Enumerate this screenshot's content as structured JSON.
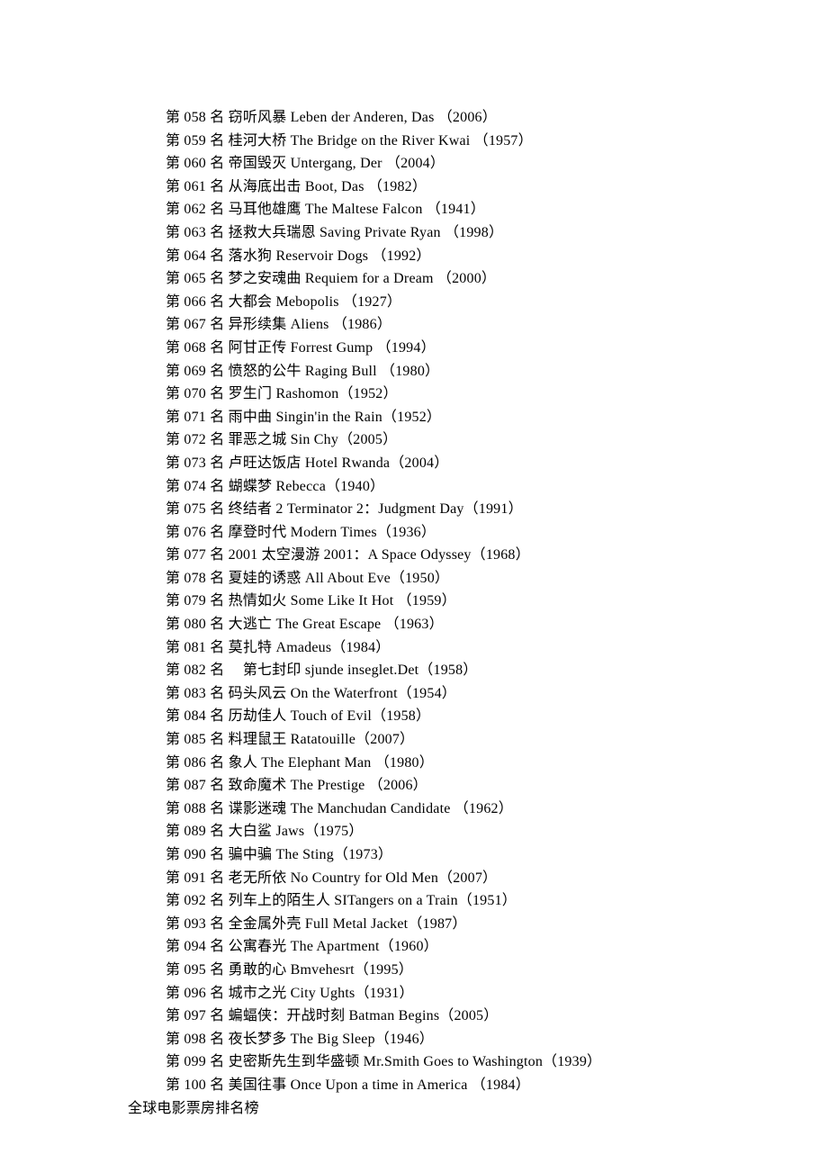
{
  "movies": {
    "items": [
      {
        "rank": "058",
        "cn": "窃听风暴",
        "en": "Leben der Anderen, Das ",
        "year": "（2006）"
      },
      {
        "rank": "059",
        "cn": "桂河大桥",
        "en": "The Bridge on the River Kwai ",
        "year": "（1957）"
      },
      {
        "rank": "060",
        "cn": "帝国毁灭",
        "en": "Untergang, Der ",
        "year": "（2004）"
      },
      {
        "rank": "061",
        "cn": "从海底出击",
        "en": "Boot, Das ",
        "year": "（1982）"
      },
      {
        "rank": "062",
        "cn": "马耳他雄鹰",
        "en": "The Maltese Falcon ",
        "year": "（1941）"
      },
      {
        "rank": "063",
        "cn": "拯救大兵瑞恩",
        "en": "Saving Private Ryan ",
        "year": "（1998）"
      },
      {
        "rank": "064",
        "cn": "落水狗",
        "en": "Reservoir Dogs ",
        "year": "（1992）"
      },
      {
        "rank": "065",
        "cn": "梦之安魂曲",
        "en": "Requiem for a Dream ",
        "year": "（2000）"
      },
      {
        "rank": "066",
        "cn": "大都会",
        "en": "Mebopolis ",
        "year": "（1927）"
      },
      {
        "rank": "067",
        "cn": "异形续集",
        "en": "Aliens ",
        "year": "（1986）"
      },
      {
        "rank": "068",
        "cn": "阿甘正传",
        "en": "Forrest Gump ",
        "year": "（1994）"
      },
      {
        "rank": "069",
        "cn": "愤怒的公牛",
        "en": "Raging Bull ",
        "year": "（1980）"
      },
      {
        "rank": "070",
        "cn": "罗生门",
        "en": "Rashomon",
        "year": "（1952）"
      },
      {
        "rank": "071",
        "cn": "雨中曲",
        "en": "Singin'in the Rain",
        "year": "（1952）"
      },
      {
        "rank": "072",
        "cn": "罪恶之城",
        "en": "Sin Chy",
        "year": "（2005）"
      },
      {
        "rank": "073",
        "cn": "卢旺达饭店",
        "en": "Hotel Rwanda",
        "year": "（2004）"
      },
      {
        "rank": "074",
        "cn": "蝴蝶梦",
        "en": "Rebecca",
        "year": "（1940）"
      },
      {
        "rank": "075",
        "cn": "终结者 2",
        "en": "Terminator 2：Judgment Day",
        "year": "（1991）"
      },
      {
        "rank": "076",
        "cn": "摩登时代",
        "en": "Modern Times",
        "year": "（1936）"
      },
      {
        "rank": "077",
        "cn": "2001 太空漫游",
        "en": "2001：A Space Odyssey",
        "year": "（1968）"
      },
      {
        "rank": "078",
        "cn": "夏娃的诱惑",
        "en": "All About Eve",
        "year": "（1950）"
      },
      {
        "rank": "079",
        "cn": "热情如火",
        "en": "Some Like It Hot ",
        "year": "（1959）"
      },
      {
        "rank": "080",
        "cn": "大逃亡",
        "en": "The Great Escape ",
        "year": "（1963）"
      },
      {
        "rank": "081",
        "cn": "莫扎特",
        "en": "Amadeus",
        "year": "（1984）"
      },
      {
        "rank": "082",
        "cn": "　第七封印",
        "en": "sjunde inseglet.Det",
        "year": "（1958）"
      },
      {
        "rank": "083",
        "cn": "码头风云",
        "en": "On the Waterfront",
        "year": "（1954）"
      },
      {
        "rank": "084",
        "cn": "历劫佳人",
        "en": "Touch of Evil",
        "year": "（1958）"
      },
      {
        "rank": "085",
        "cn": "料理鼠王",
        "en": "Ratatouille",
        "year": "（2007）"
      },
      {
        "rank": "086",
        "cn": "象人",
        "en": "The Elephant Man ",
        "year": "（1980）"
      },
      {
        "rank": "087",
        "cn": "致命魔术",
        "en": "The Prestige ",
        "year": "（2006）"
      },
      {
        "rank": "088",
        "cn": "谍影迷魂",
        "en": "The Manchudan Candidate ",
        "year": "（1962）"
      },
      {
        "rank": "089",
        "cn": "大白鲨",
        "en": "Jaws",
        "year": "（1975）"
      },
      {
        "rank": "090",
        "cn": "骗中骗",
        "en": "The Sting",
        "year": "（1973）"
      },
      {
        "rank": "091",
        "cn": "老无所依",
        "en": "No Country for Old Men",
        "year": "（2007）"
      },
      {
        "rank": "092",
        "cn": "列车上的陌生人",
        "en": "SITangers on a Train",
        "year": "（1951）"
      },
      {
        "rank": "093",
        "cn": "全金属外壳",
        "en": "Full Metal Jacket",
        "year": "（1987）"
      },
      {
        "rank": "094",
        "cn": "公寓春光",
        "en": "The Apartment",
        "year": "（1960）"
      },
      {
        "rank": "095",
        "cn": "勇敢的心",
        "en": "Bmvehesrt",
        "year": "（1995）"
      },
      {
        "rank": "096",
        "cn": "城市之光",
        "en": "City Ughts",
        "year": "（1931）"
      },
      {
        "rank": "097",
        "cn": "蝙蝠侠：开战时刻",
        "en": "Batman Begins",
        "year": "（2005）"
      },
      {
        "rank": "098",
        "cn": "夜长梦多",
        "en": "The Big Sleep",
        "year": "（1946）"
      },
      {
        "rank": "099",
        "cn": "史密斯先生到华盛顿",
        "en": "Mr.Smith Goes to Washington",
        "year": "（1939）"
      },
      {
        "rank": "100",
        "cn": "美国往事",
        "en": "Once Upon a time in America ",
        "year": "（1984）"
      }
    ],
    "rank_prefix": "第 ",
    "rank_suffix": " 名  "
  },
  "footer": "全球电影票房排名榜"
}
